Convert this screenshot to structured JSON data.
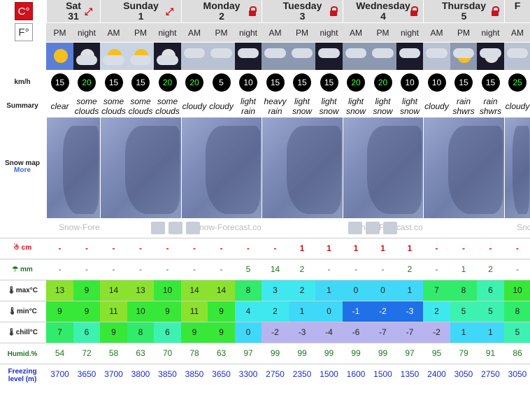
{
  "units": {
    "celsius": "C°",
    "fahrenheit": "F°",
    "speed": "km/h"
  },
  "labels": {
    "summary": "Summary",
    "snow_map": "Snow map",
    "more": "More",
    "snow": "cm",
    "rain": "mm",
    "max": "max°C",
    "min": "min°C",
    "chill": "chill°C",
    "humid": "Humid.%",
    "freezing": "Freezing level (m)"
  },
  "watermark": "Snow-Forecast.com",
  "days": [
    {
      "name": "Sat",
      "num": "31"
    },
    {
      "name": "Sunday",
      "num": "1"
    },
    {
      "name": "Monday",
      "num": "2"
    },
    {
      "name": "Tuesday",
      "num": "3"
    },
    {
      "name": "Wednesday",
      "num": "4"
    },
    {
      "name": "Thursday",
      "num": "5"
    },
    {
      "name": "F",
      "num": ""
    }
  ],
  "periods": [
    "PM",
    "night",
    "AM",
    "PM",
    "night",
    "AM",
    "PM",
    "night",
    "AM",
    "PM",
    "night",
    "AM",
    "PM",
    "night",
    "AM",
    "PM",
    "night",
    "AM"
  ],
  "wind": [
    "15",
    "20",
    "15",
    "15",
    "20",
    "20",
    "5",
    "10",
    "15",
    "15",
    "15",
    "20",
    "20",
    "10",
    "10",
    "15",
    "15",
    "25"
  ],
  "wind_green": [
    false,
    true,
    false,
    false,
    true,
    true,
    false,
    false,
    false,
    false,
    false,
    true,
    true,
    false,
    false,
    false,
    false,
    true
  ],
  "summary": [
    "clear",
    "some clouds",
    "some clouds",
    "some clouds",
    "some clouds",
    "cloudy",
    "cloudy",
    "light rain",
    "heavy rain",
    "light snow",
    "light snow",
    "light snow",
    "light snow",
    "light snow",
    "cloudy",
    "rain shwrs",
    "rain shwrs",
    "cloudy"
  ],
  "snow": [
    "-",
    "-",
    "-",
    "-",
    "-",
    "-",
    "-",
    "-",
    "-",
    "1",
    "1",
    "1",
    "1",
    "1",
    "-",
    "-",
    "-",
    "-"
  ],
  "rain": [
    "-",
    "-",
    "-",
    "-",
    "-",
    "-",
    "-",
    "5",
    "14",
    "2",
    "-",
    "-",
    "-",
    "2",
    "-",
    "1",
    "2",
    "-"
  ],
  "max": [
    "13",
    "9",
    "14",
    "13",
    "10",
    "14",
    "14",
    "8",
    "3",
    "2",
    "1",
    "0",
    "0",
    "1",
    "7",
    "8",
    "6",
    "10"
  ],
  "min": [
    "9",
    "9",
    "11",
    "10",
    "9",
    "11",
    "9",
    "4",
    "2",
    "1",
    "0",
    "-1",
    "-2",
    "-3",
    "2",
    "5",
    "5",
    "8"
  ],
  "chill": [
    "7",
    "6",
    "9",
    "8",
    "6",
    "9",
    "9",
    "0",
    "-2",
    "-3",
    "-4",
    "-6",
    "-7",
    "-7",
    "-2",
    "1",
    "1",
    "5"
  ],
  "humid": [
    "54",
    "72",
    "58",
    "63",
    "70",
    "78",
    "63",
    "97",
    "99",
    "99",
    "99",
    "99",
    "99",
    "97",
    "95",
    "79",
    "91",
    "86"
  ],
  "freezing": [
    "3700",
    "3650",
    "3700",
    "3800",
    "3850",
    "3850",
    "3650",
    "3300",
    "2750",
    "2350",
    "1500",
    "1600",
    "1500",
    "1350",
    "2400",
    "3050",
    "2750",
    "3050"
  ],
  "colors": {
    "accent": "#d0101b",
    "header_bg": "#dddddd",
    "label_blue": "#1a2ccc",
    "label_green": "#1a7a1a"
  }
}
